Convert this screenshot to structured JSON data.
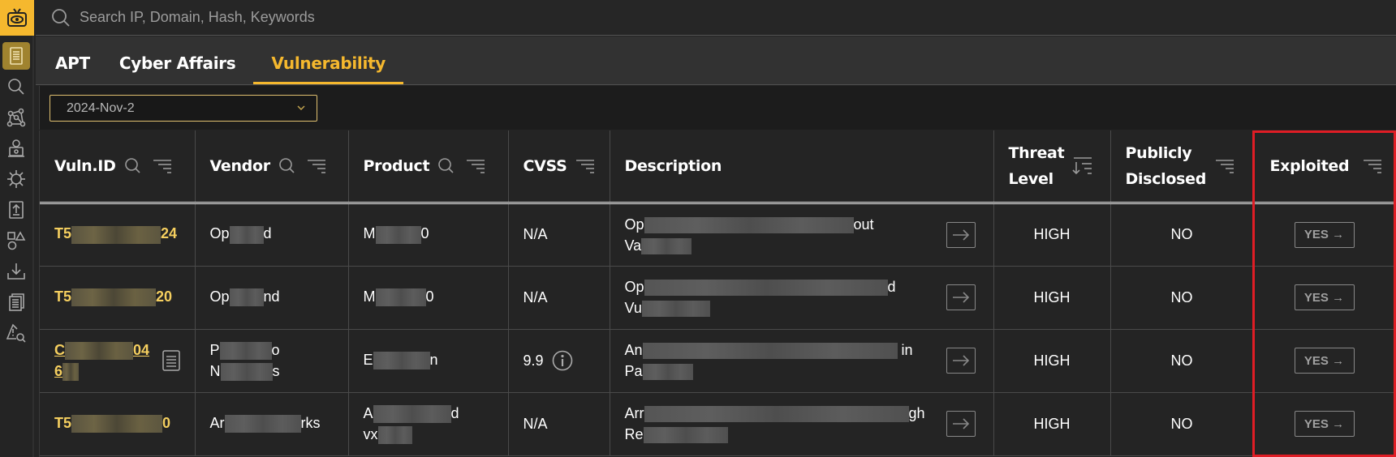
{
  "search": {
    "placeholder": "Search IP, Domain, Hash, Keywords",
    "icon": "search-icon"
  },
  "sidebar": {
    "logo_icon": "eye-tv-logo-icon",
    "items": [
      {
        "name": "reports",
        "icon": "document-icon",
        "active": true
      },
      {
        "name": "search",
        "icon": "search-icon",
        "active": false
      },
      {
        "name": "graph",
        "icon": "network-graph-icon",
        "active": false
      },
      {
        "name": "threat-actor",
        "icon": "hacker-icon",
        "active": false
      },
      {
        "name": "malware",
        "icon": "virus-icon",
        "active": false
      },
      {
        "name": "upload",
        "icon": "upload-icon",
        "active": false
      },
      {
        "name": "shapes",
        "icon": "shapes-icon",
        "active": false
      },
      {
        "name": "download",
        "icon": "download-icon",
        "active": false
      },
      {
        "name": "documents",
        "icon": "stacked-documents-icon",
        "active": false
      },
      {
        "name": "alert-search",
        "icon": "warning-search-icon",
        "active": false
      }
    ]
  },
  "tabs": [
    {
      "label": "APT",
      "active": false
    },
    {
      "label": "Cyber Affairs",
      "active": false
    },
    {
      "label": "Vulnerability",
      "active": true
    }
  ],
  "filter": {
    "date_value": "2024-Nov-2"
  },
  "table": {
    "columns": [
      {
        "label": "Vuln.ID",
        "searchable": true,
        "filterable": true
      },
      {
        "label": "Vendor",
        "searchable": true,
        "filterable": true
      },
      {
        "label": "Product",
        "searchable": true,
        "filterable": true
      },
      {
        "label": "CVSS",
        "searchable": false,
        "filterable": true
      },
      {
        "label": "Description",
        "searchable": false,
        "filterable": false
      },
      {
        "label": "Threat Level",
        "line1": "Threat",
        "line2": "Level",
        "sortable": true
      },
      {
        "label": "Publicly Disclosed",
        "line1": "Publicly",
        "line2": "Disclosed",
        "filterable": true
      },
      {
        "label": "Exploited",
        "filterable": true
      }
    ],
    "rows": [
      {
        "id_prefix": "T5",
        "id_suffix": "24",
        "id_line2": "",
        "vendor_prefix": "Op",
        "vendor_suffix": "d",
        "vendor_line2": "",
        "product_prefix": "M",
        "product_suffix": "0",
        "product_line2": "",
        "cvss": "N/A",
        "desc_line1_prefix": "Op",
        "desc_line1_suffix": "out",
        "desc_line2_prefix": "Va",
        "threat_level": "HIGH",
        "publicly_disclosed": "NO",
        "exploited": "YES →"
      },
      {
        "id_prefix": "T5",
        "id_suffix": "20",
        "id_line2": "",
        "vendor_prefix": "Op",
        "vendor_suffix": "nd",
        "vendor_line2": "",
        "product_prefix": "M",
        "product_suffix": "0",
        "product_line2": "",
        "cvss": "N/A",
        "desc_line1_prefix": "Op",
        "desc_line1_suffix": "d",
        "desc_line2_prefix": "Vu",
        "threat_level": "HIGH",
        "publicly_disclosed": "NO",
        "exploited": "YES →"
      },
      {
        "id_prefix": "C",
        "id_suffix": "04",
        "id_line2": "6",
        "vendor_prefix": "P",
        "vendor_suffix": "o",
        "vendor_line2_prefix": "N",
        "vendor_line2_suffix": "s",
        "product_prefix": "E",
        "product_suffix": "n",
        "product_line2": "",
        "cvss": "9.9",
        "desc_line1_prefix": "An",
        "desc_line1_suffix": "in",
        "desc_line2_prefix": "Pa",
        "threat_level": "HIGH",
        "publicly_disclosed": "NO",
        "exploited": "YES →"
      },
      {
        "id_prefix": "T5",
        "id_suffix": "0",
        "id_line2": "",
        "vendor_prefix": "Ar",
        "vendor_suffix": "rks",
        "vendor_line2": "",
        "product_prefix": "A",
        "product_suffix": "d",
        "product_line2_prefix": "vx",
        "cvss": "N/A",
        "desc_line1_prefix": "Arr",
        "desc_line1_suffix": "gh",
        "desc_line2_prefix": "Re",
        "threat_level": "HIGH",
        "publicly_disclosed": "NO",
        "exploited": "YES →"
      }
    ]
  },
  "highlight": {
    "target": "Exploited column",
    "color": "#e01d25"
  },
  "colors": {
    "accent": "#f5b82e",
    "link": "#f5cf5f",
    "highlight": "#e01d25"
  }
}
